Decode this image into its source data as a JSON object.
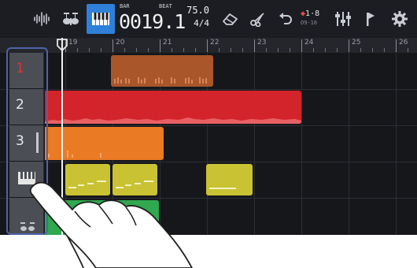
{
  "toolbar": {
    "buttons": [
      {
        "name": "waveform-icon",
        "active": false
      },
      {
        "name": "drum-kit-icon",
        "active": false
      },
      {
        "name": "piano-keyboard-icon",
        "active": true
      }
    ],
    "position": {
      "unit_label": "BAR",
      "beat_label": "BEAT",
      "value": "0019.1"
    },
    "tempo": "75.0",
    "meter": "4/4",
    "loop_range": {
      "start": "1",
      "end": "8",
      "sub": "O9-16"
    },
    "right_icons": [
      "eraser-icon",
      "scissors-icon",
      "undo-icon",
      "mixer-icon",
      "marker-flag-icon",
      "settings-gear-icon"
    ]
  },
  "ruler": {
    "bars": [
      "19",
      "20",
      "21",
      "22",
      "23",
      "24",
      "25",
      "26"
    ]
  },
  "tracks": [
    {
      "label": "1",
      "type": "audio",
      "selected_color": "red"
    },
    {
      "label": "2",
      "type": "audio"
    },
    {
      "label": "3",
      "type": "audio"
    },
    {
      "label": "keyboard",
      "type": "synth"
    },
    {
      "label": "drums",
      "type": "drum"
    }
  ],
  "colors": {
    "track1": "#a9562b",
    "track2": "#d3242b",
    "track3": "#ea7a23",
    "track4": "#c9c233",
    "track5": "#2fa84f",
    "accent": "#2f80d8",
    "selection_frame": "#4f63a8"
  }
}
